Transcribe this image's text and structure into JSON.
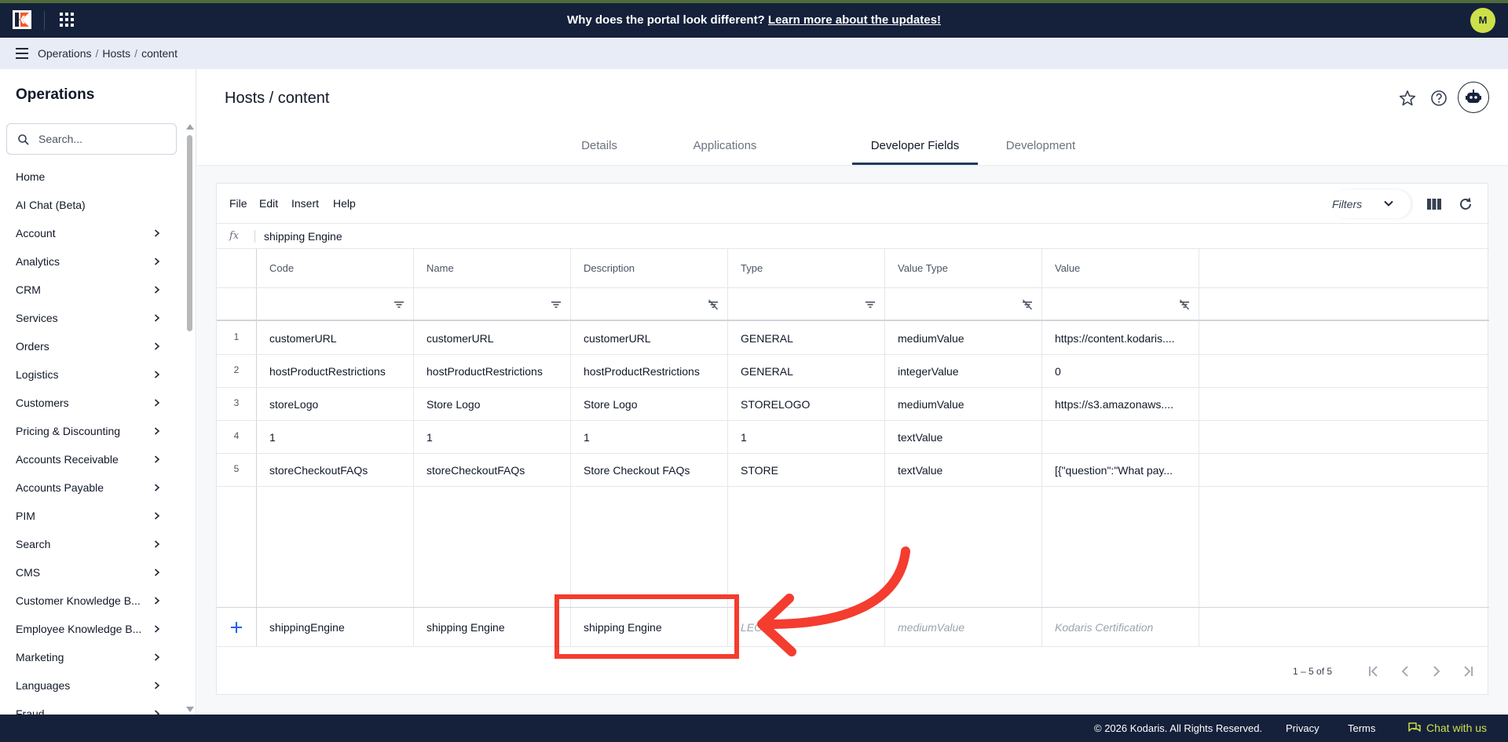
{
  "topbar": {
    "banner_text": "Why does the portal look different?",
    "banner_link": "Learn more about the updates!",
    "avatar_initial": "M"
  },
  "breadcrumb": {
    "items": [
      "Operations",
      "Hosts",
      "content"
    ]
  },
  "sidebar": {
    "title": "Operations",
    "search_placeholder": "Search...",
    "items": [
      {
        "label": "Home",
        "chevron": false
      },
      {
        "label": "AI Chat (Beta)",
        "chevron": false
      },
      {
        "label": "Account",
        "chevron": true
      },
      {
        "label": "Analytics",
        "chevron": true
      },
      {
        "label": "CRM",
        "chevron": true
      },
      {
        "label": "Services",
        "chevron": true
      },
      {
        "label": "Orders",
        "chevron": true
      },
      {
        "label": "Logistics",
        "chevron": true
      },
      {
        "label": "Customers",
        "chevron": true
      },
      {
        "label": "Pricing & Discounting",
        "chevron": true
      },
      {
        "label": "Accounts Receivable",
        "chevron": true
      },
      {
        "label": "Accounts Payable",
        "chevron": true
      },
      {
        "label": "PIM",
        "chevron": true
      },
      {
        "label": "Search",
        "chevron": true
      },
      {
        "label": "CMS",
        "chevron": true
      },
      {
        "label": "Customer Knowledge B...",
        "chevron": true
      },
      {
        "label": "Employee Knowledge B...",
        "chevron": true
      },
      {
        "label": "Marketing",
        "chevron": true
      },
      {
        "label": "Languages",
        "chevron": true
      },
      {
        "label": "Fraud",
        "chevron": true
      }
    ]
  },
  "page": {
    "title": "Hosts / content",
    "tabs": [
      {
        "label": "Details",
        "active": false
      },
      {
        "label": "Applications",
        "active": false
      },
      {
        "label": "Developer Fields",
        "active": true
      },
      {
        "label": "Development",
        "active": false
      }
    ]
  },
  "grid": {
    "menu": [
      "File",
      "Edit",
      "Insert",
      "Help"
    ],
    "filters_label": "Filters",
    "fx_label": "fx",
    "formula_value": "shipping Engine",
    "columns": [
      "Code",
      "Name",
      "Description",
      "Type",
      "Value Type",
      "Value"
    ],
    "rows": [
      {
        "num": "1",
        "cells": [
          "customerURL",
          "customerURL",
          "customerURL",
          "GENERAL",
          "mediumValue",
          "https://content.kodaris...."
        ]
      },
      {
        "num": "2",
        "cells": [
          "hostProductRestrictions",
          "hostProductRestrictions",
          "hostProductRestrictions",
          "GENERAL",
          "integerValue",
          "0"
        ]
      },
      {
        "num": "3",
        "cells": [
          "storeLogo",
          "Store Logo",
          "Store Logo",
          "STORELOGO",
          "mediumValue",
          "https://s3.amazonaws...."
        ]
      },
      {
        "num": "4",
        "cells": [
          "1",
          "1",
          "1",
          "1",
          "textValue",
          ""
        ]
      },
      {
        "num": "5",
        "cells": [
          "storeCheckoutFAQs",
          "storeCheckoutFAQs",
          "Store Checkout FAQs",
          "STORE",
          "textValue",
          "[{\"question\":\"What pay..."
        ]
      }
    ],
    "new_row": {
      "code": "shippingEngine",
      "name": "shipping Engine",
      "description": "shipping Engine",
      "type_placeholder": "LEC",
      "value_type_placeholder": "mediumValue",
      "value_placeholder": "Kodaris Certification"
    },
    "pagination": "1 – 5 of 5"
  },
  "footer": {
    "copyright": "© 2026 Kodaris. All Rights Reserved.",
    "privacy": "Privacy",
    "terms": "Terms",
    "chat": "Chat with us"
  },
  "colors": {
    "topbar_bg": "#15213b",
    "accent_lime": "#cde04a",
    "annotation_red": "#f43c2f",
    "active_tab": "#1e3a5f"
  }
}
